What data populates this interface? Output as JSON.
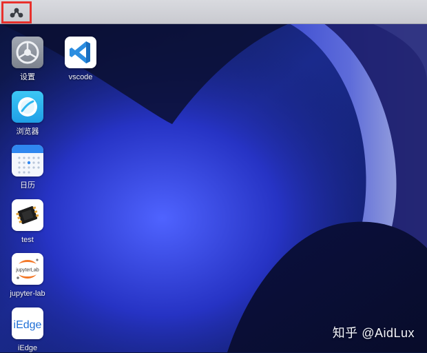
{
  "topbar": {
    "start_icon": "aidlux-logo-icon"
  },
  "desktop_icons": {
    "settings": {
      "label": "设置",
      "icon": "gear-icon"
    },
    "vscode": {
      "label": "vscode",
      "icon": "vscode-icon"
    },
    "browser": {
      "label": "浏览器",
      "icon": "browser-icon"
    },
    "calendar": {
      "label": "日历",
      "icon": "calendar-icon"
    },
    "test": {
      "label": "test",
      "icon": "chip-icon"
    },
    "jupyter": {
      "label": "jupyter-lab",
      "icon": "jupyterlab-icon",
      "logo_text": "jupyterLab"
    },
    "iedge": {
      "label": "iEdge",
      "icon": "iedge-icon",
      "logo_text": "iEdge"
    }
  },
  "watermark": {
    "text": "知乎 @AidLux"
  },
  "colors": {
    "highlight_border": "#e8302c",
    "vscode_blue": "#2b8de0",
    "browser_cyan": "#2bb7f0"
  }
}
